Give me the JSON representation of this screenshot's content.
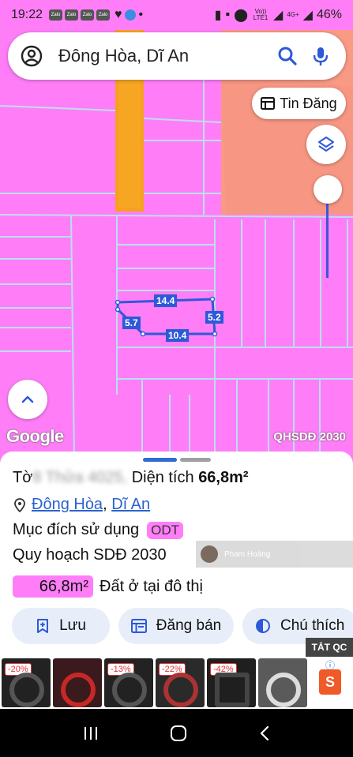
{
  "status_bar": {
    "time": "19:22",
    "notifications": [
      "Zalo",
      "Zalo",
      "Zalo",
      "Zalo"
    ],
    "network_label": "Vo)) LTE1",
    "network_type": "4G+",
    "battery": "46%"
  },
  "search": {
    "query": "Đông Hòa, Dĩ An"
  },
  "map": {
    "tin_dang_label": "Tin Đăng",
    "google_label": "Google",
    "layer_label": "QHSDĐ 2030",
    "dimensions": [
      "14.4",
      "5.7",
      "5.2",
      "10.4"
    ]
  },
  "parcel": {
    "to_prefix": "Tờ",
    "to_hidden": "8 Thửa 4025,",
    "area_prefix": "Diện tích",
    "area_value": "66,8m²",
    "ward": "Đông Hòa",
    "separator": ",",
    "district": "Dĩ An",
    "purpose_label": "Mục đích sử dụng",
    "purpose_code": "ODT",
    "plan_label": "Quy hoạch SDĐ 2030",
    "plan_area": "66,8m²",
    "plan_desc": "Đất ở tại đô thị",
    "watermark_name": "Pham Hoàng"
  },
  "actions": {
    "save": "Lưu",
    "sell": "Đăng bán",
    "legend": "Chú thích"
  },
  "ad": {
    "close_label": "TẮT QC",
    "discounts": [
      "-20%",
      "",
      "-13%",
      "-22%",
      "-42%",
      ""
    ]
  },
  "colors": {
    "planning_pink": "#ff7ef8",
    "road_orange": "#f5a623",
    "accent_blue": "#2d59d8"
  }
}
